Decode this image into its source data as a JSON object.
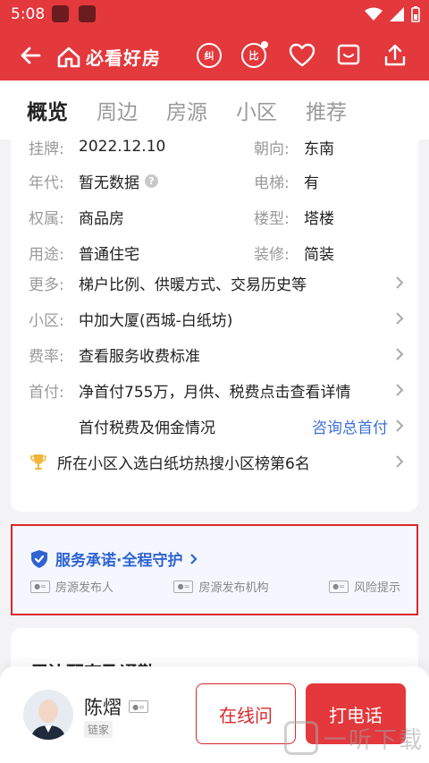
{
  "status_bar": {
    "time": "5:08"
  },
  "header": {
    "brand": "必看好房",
    "jiu_label": "纠",
    "bi_label": "比"
  },
  "tabs": [
    "概览",
    "周边",
    "房源",
    "小区",
    "推荐"
  ],
  "details": {
    "listed_label": "挂牌:",
    "listed_value": "2022.12.10",
    "orientation_label": "朝向:",
    "orientation_value": "东南",
    "year_label": "年代:",
    "year_value": "暂无数据",
    "elevator_label": "电梯:",
    "elevator_value": "有",
    "ownership_label": "权属:",
    "ownership_value": "商品房",
    "building_label": "楼型:",
    "building_value": "塔楼",
    "usage_label": "用途:",
    "usage_value": "普通住宅",
    "decoration_label": "装修:",
    "decoration_value": "简装",
    "more_label": "更多:",
    "more_value": "梯户比例、供暖方式、交易历史等",
    "community_label": "小区:",
    "community_value": "中加大厦(西城-白纸坊)",
    "fee_label": "费率:",
    "fee_value": "查看服务收费标准",
    "downpay_label": "首付:",
    "downpay_value": "净首付755万，月供、税费点击查看详情",
    "tax_value": "首付税费及佣金情况",
    "tax_link": "咨询总首付",
    "rank_value": "所在小区入选白纸坊热搜小区榜第6名"
  },
  "service": {
    "title": "服务承诺·全程守护",
    "items": [
      "房源发布人",
      "房源发布机构",
      "风险提示"
    ]
  },
  "next_section": {
    "title": "周边配套及通勤"
  },
  "agent": {
    "name": "陈熠",
    "tag": "链家"
  },
  "actions": {
    "online": "在线问",
    "call": "打电话"
  },
  "watermark": {
    "text": "一听下载"
  },
  "colors": {
    "brand_red": "#e3383c",
    "link_blue": "#3b6fd8"
  }
}
